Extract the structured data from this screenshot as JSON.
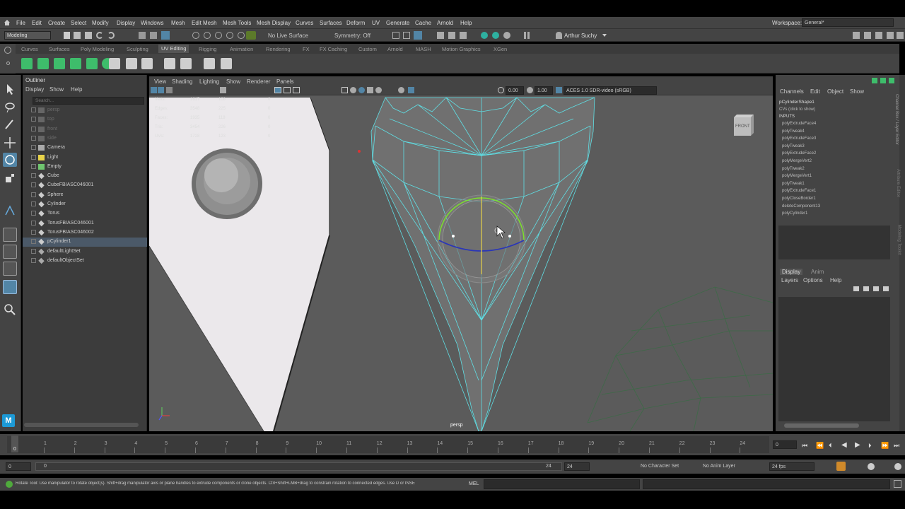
{
  "menubar": {
    "items": [
      "File",
      "Edit",
      "Create",
      "Select",
      "Modify",
      "Display",
      "Windows",
      "Mesh",
      "Edit Mesh",
      "Mesh Tools",
      "Mesh Display",
      "Curves",
      "Surfaces",
      "Deform",
      "UV",
      "Generate",
      "Cache",
      "Arnold",
      "Help"
    ],
    "workspace_label": "Workspace:",
    "workspace_value": "General*"
  },
  "statusline": {
    "mode": "Modeling",
    "live_surface": "No Live Surface",
    "symmetry": "Symmetry: Off",
    "user": "Arthur Suchy"
  },
  "shelf": {
    "tabs": [
      "Curves",
      "Surfaces",
      "Poly Modeling",
      "Sculpting",
      "UV Editing",
      "Rigging",
      "Animation",
      "Rendering",
      "FX",
      "FX Caching",
      "Custom",
      "Arnold",
      "MASH",
      "Motion Graphics",
      "XGen"
    ],
    "active_tab": "UV Editing"
  },
  "outliner": {
    "title": "Outliner",
    "menu": [
      "Display",
      "Show",
      "Help"
    ],
    "search_placeholder": "Search...",
    "items": [
      {
        "label": "persp",
        "dim": true,
        "icon": "camera-icon"
      },
      {
        "label": "top",
        "dim": true,
        "icon": "camera-icon"
      },
      {
        "label": "front",
        "dim": true,
        "icon": "camera-icon"
      },
      {
        "label": "side",
        "dim": true,
        "icon": "camera-icon"
      },
      {
        "label": "Camera",
        "dim": false,
        "icon": "camera-icon"
      },
      {
        "label": "Light",
        "dim": false,
        "icon": "light-icon"
      },
      {
        "label": "Empty",
        "dim": false,
        "icon": "locator-icon"
      },
      {
        "label": "Cube",
        "dim": false,
        "icon": "mesh-icon"
      },
      {
        "label": "CubeFBIASC046001",
        "dim": false,
        "icon": "mesh-icon"
      },
      {
        "label": "Sphere",
        "dim": false,
        "icon": "mesh-icon"
      },
      {
        "label": "Cylinder",
        "dim": false,
        "icon": "mesh-icon"
      },
      {
        "label": "Torus",
        "dim": false,
        "icon": "mesh-icon"
      },
      {
        "label": "TorusFBIASC046001",
        "dim": false,
        "icon": "mesh-icon"
      },
      {
        "label": "TorusFBIASC046002",
        "dim": false,
        "icon": "mesh-icon"
      },
      {
        "label": "pCylinder1",
        "dim": false,
        "icon": "mesh-icon",
        "selected": true
      },
      {
        "label": "defaultLightSet",
        "dim": false,
        "icon": "set-icon"
      },
      {
        "label": "defaultObjectSet",
        "dim": false,
        "icon": "set-icon"
      }
    ]
  },
  "viewport": {
    "menu": [
      "View",
      "Shading",
      "Lighting",
      "Show",
      "Renderer",
      "Panels"
    ],
    "exposure": "0.00",
    "gamma": "1.00",
    "color_space": "ACES 1.0 SDR-video (sRGB)",
    "camera_label": "persp",
    "viewcube_label": "FRONT",
    "hud": [
      {
        "name": "Verts:",
        "v1": "1617",
        "v2": "108",
        "v3": "0"
      },
      {
        "name": "Edges:",
        "v1": "3548",
        "v2": "225",
        "v3": "0"
      },
      {
        "name": "Faces:",
        "v1": "1935",
        "v2": "118",
        "v3": "0"
      },
      {
        "name": "Tris:",
        "v1": "3454",
        "v2": "226",
        "v3": "0"
      },
      {
        "name": "UVs:",
        "v1": "1728",
        "v2": "123",
        "v3": "0"
      }
    ]
  },
  "channelbox": {
    "menu": [
      "Channels",
      "Edit",
      "Object",
      "Show"
    ],
    "shape": "pCylinderShape1",
    "cvs": "CVs (click to show)",
    "inputs_label": "INPUTS",
    "inputs": [
      "polyExtrudeFace4",
      "polyTweak4",
      "polyExtrudeFace3",
      "polyTweak3",
      "polyExtrudeFace2",
      "polyMergeVert2",
      "polyTweak2",
      "polyMergeVert1",
      "polyTweak1",
      "polyExtrudeFace1",
      "polyCloseBorder1",
      "deleteComponent13",
      "polyCylinder1"
    ],
    "layer_tabs": [
      "Display",
      "Anim"
    ],
    "layer_menu": [
      "Layers",
      "Options",
      "Help"
    ],
    "side_tabs": [
      "Channel Box / Layer Editor",
      "Attribute Editor",
      "Modeling Toolkit"
    ]
  },
  "timeline": {
    "ticks": [
      "1",
      "2",
      "3",
      "4",
      "5",
      "6",
      "7",
      "8",
      "9",
      "10",
      "11",
      "12",
      "13",
      "14",
      "15",
      "16",
      "17",
      "18",
      "19",
      "20",
      "21",
      "22",
      "23",
      "24"
    ],
    "current_frame": "0",
    "cursor_frame": "0"
  },
  "range": {
    "start": "0",
    "inner_start": "0",
    "inner_end": "24",
    "end": "24",
    "character_set": "No Character Set",
    "anim_layer": "No Anim Layer",
    "fps": "24 fps"
  },
  "helpline": {
    "text": "Rotate Tool: Use manipulator to rotate object(s). Shift+drag manipulator axis or plane handles to extrude components or clone objects. Ctrl+Shift+LMB+drag to constrain rotation to connected edges. Use D or INSE",
    "mel_label": "MEL"
  },
  "colors": {
    "accent": "#5285a6",
    "wire": "#5fe0e6",
    "green_ring": "#7ce02c",
    "blue_ring": "#2a36b8",
    "viewport_bg": "#5b5b5b"
  }
}
